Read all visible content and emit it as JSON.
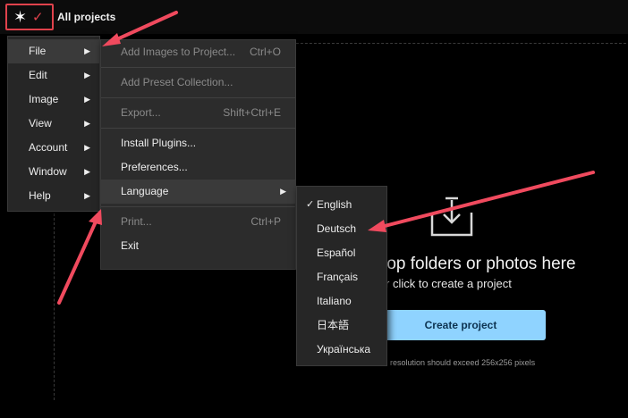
{
  "app": {
    "title": "All projects"
  },
  "main_menu": {
    "items": [
      {
        "label": "File",
        "active": true
      },
      {
        "label": "Edit"
      },
      {
        "label": "Image"
      },
      {
        "label": "View"
      },
      {
        "label": "Account"
      },
      {
        "label": "Window"
      },
      {
        "label": "Help"
      }
    ]
  },
  "file_menu": {
    "items": [
      {
        "label": "Add Images to Project...",
        "shortcut": "Ctrl+O",
        "disabled": true
      },
      {
        "label": "Add Preset Collection...",
        "disabled": true
      },
      {
        "label": "Export...",
        "shortcut": "Shift+Ctrl+E",
        "disabled": true
      },
      {
        "label": "Install Plugins..."
      },
      {
        "label": "Preferences..."
      },
      {
        "label": "Language",
        "active": true
      },
      {
        "label": "Print...",
        "shortcut": "Ctrl+P",
        "disabled": true
      },
      {
        "label": "Exit"
      }
    ]
  },
  "language_menu": {
    "check_mark": "✓",
    "selected": "English",
    "items": [
      "English",
      "Deutsch",
      "Español",
      "Français",
      "Italiano",
      "日本語",
      "Українська"
    ]
  },
  "dropzone": {
    "title": "rop folders or photos here",
    "subtitle": "r click to create a project",
    "button_label": "Create project",
    "note": "resolution should exceed 256x256 pixels"
  },
  "colors": {
    "highlight": "#e0424c",
    "accent_button": "#8fd3ff",
    "menu_bg": "#262626"
  },
  "icons": {
    "logo": "star-icon",
    "checkmark": "check-icon",
    "submenu": "triangle-right-icon",
    "upload": "download-tray-icon"
  }
}
